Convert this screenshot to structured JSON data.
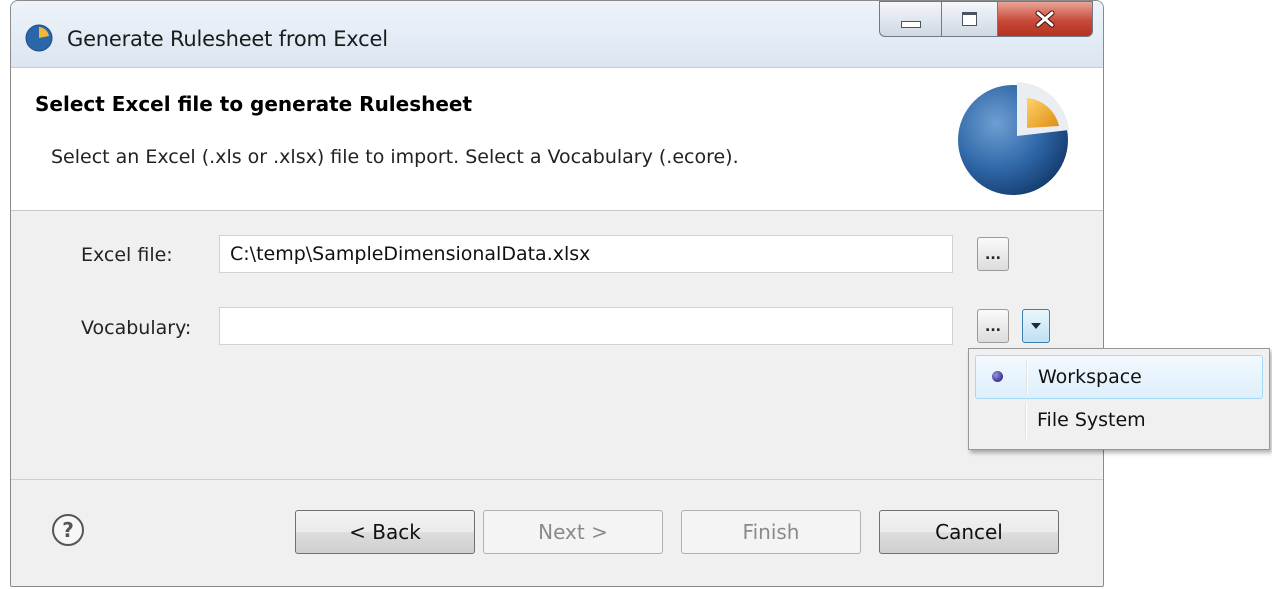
{
  "window": {
    "title": "Generate Rulesheet from Excel"
  },
  "header": {
    "title": "Select Excel file to generate Rulesheet",
    "description": "Select an Excel (.xls or .xlsx) file to import. Select a Vocabulary (.ecore)."
  },
  "form": {
    "excel_label": "Excel file:",
    "excel_value": "C:\\temp\\SampleDimensionalData.xlsx",
    "browse_label": "...",
    "vocabulary_label": "Vocabulary:",
    "vocabulary_value": ""
  },
  "menu": {
    "items": [
      {
        "label": "Workspace",
        "selected": true
      },
      {
        "label": "File System",
        "selected": false
      }
    ]
  },
  "buttons": {
    "back": "< Back",
    "next": "Next >",
    "finish": "Finish",
    "cancel": "Cancel"
  },
  "icons": {
    "help": "help-icon",
    "app": "app-logo-icon"
  },
  "colors": {
    "accent": "#2e6ca8",
    "logo_orange": "#f0a92a"
  }
}
